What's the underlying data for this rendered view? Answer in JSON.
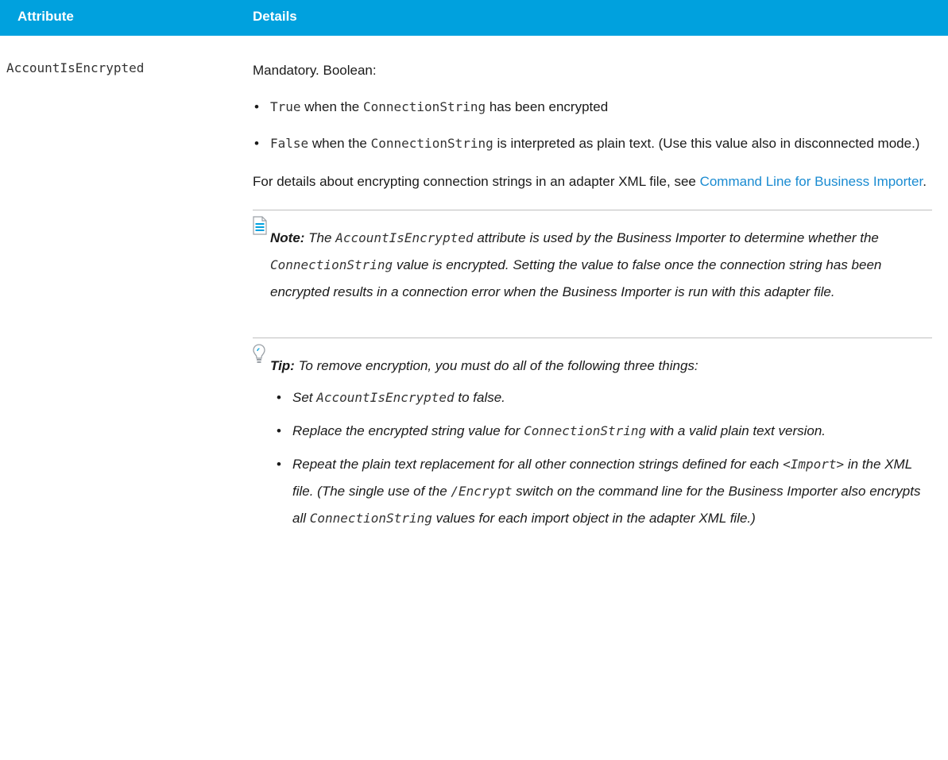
{
  "header": {
    "attribute": "Attribute",
    "details": "Details"
  },
  "row": {
    "attribute_name": "AccountIsEncrypted",
    "intro": "Mandatory. Boolean:",
    "bullet1": {
      "code": "True",
      "text": " when the ",
      "code2": "ConnectionString",
      "text2": " has been encrypted"
    },
    "bullet2": {
      "code": "False",
      "text": " when the ",
      "code2": "ConnectionString",
      "text2": " is interpreted as plain text. (Use this value also in disconnected mode.)"
    },
    "details_para": "For details about encrypting connection strings in an adapter XML file, see ",
    "details_link": "Command Line for Business Importer",
    "details_end": "."
  },
  "note": {
    "label": "Note:",
    "t1": " The ",
    "c1": "AccountIsEncrypted",
    "t2": " attribute is used by the Business Importer to determine whether the ",
    "c2": "ConnectionString",
    "t3": " value is encrypted. Setting the value to false once the connection string has been encrypted results in a connection error when the Business Importer is run with this adapter file."
  },
  "tip": {
    "label": "Tip:",
    "intro": " To remove encryption, you must do all of the following three things:",
    "items": [
      {
        "t1": "Set ",
        "c1": "AccountIsEncrypted",
        "t2": " to false."
      },
      {
        "t1": "Replace the encrypted string value for ",
        "c1": "ConnectionString",
        "t2": " with a valid plain text version."
      },
      {
        "t1": "Repeat the plain text replacement for all other connection strings defined for each ",
        "c1": "<Import>",
        "t2": " in the XML file. (The single use of the ",
        "c2": "/Encrypt",
        "t3": " switch on the command line for the Business Importer also encrypts all ",
        "c3": "ConnectionString",
        "t4": " values for each import object in the adapter XML file.)"
      }
    ]
  },
  "colors": {
    "header_bg": "#00a1de",
    "link": "#1a8bd1"
  }
}
